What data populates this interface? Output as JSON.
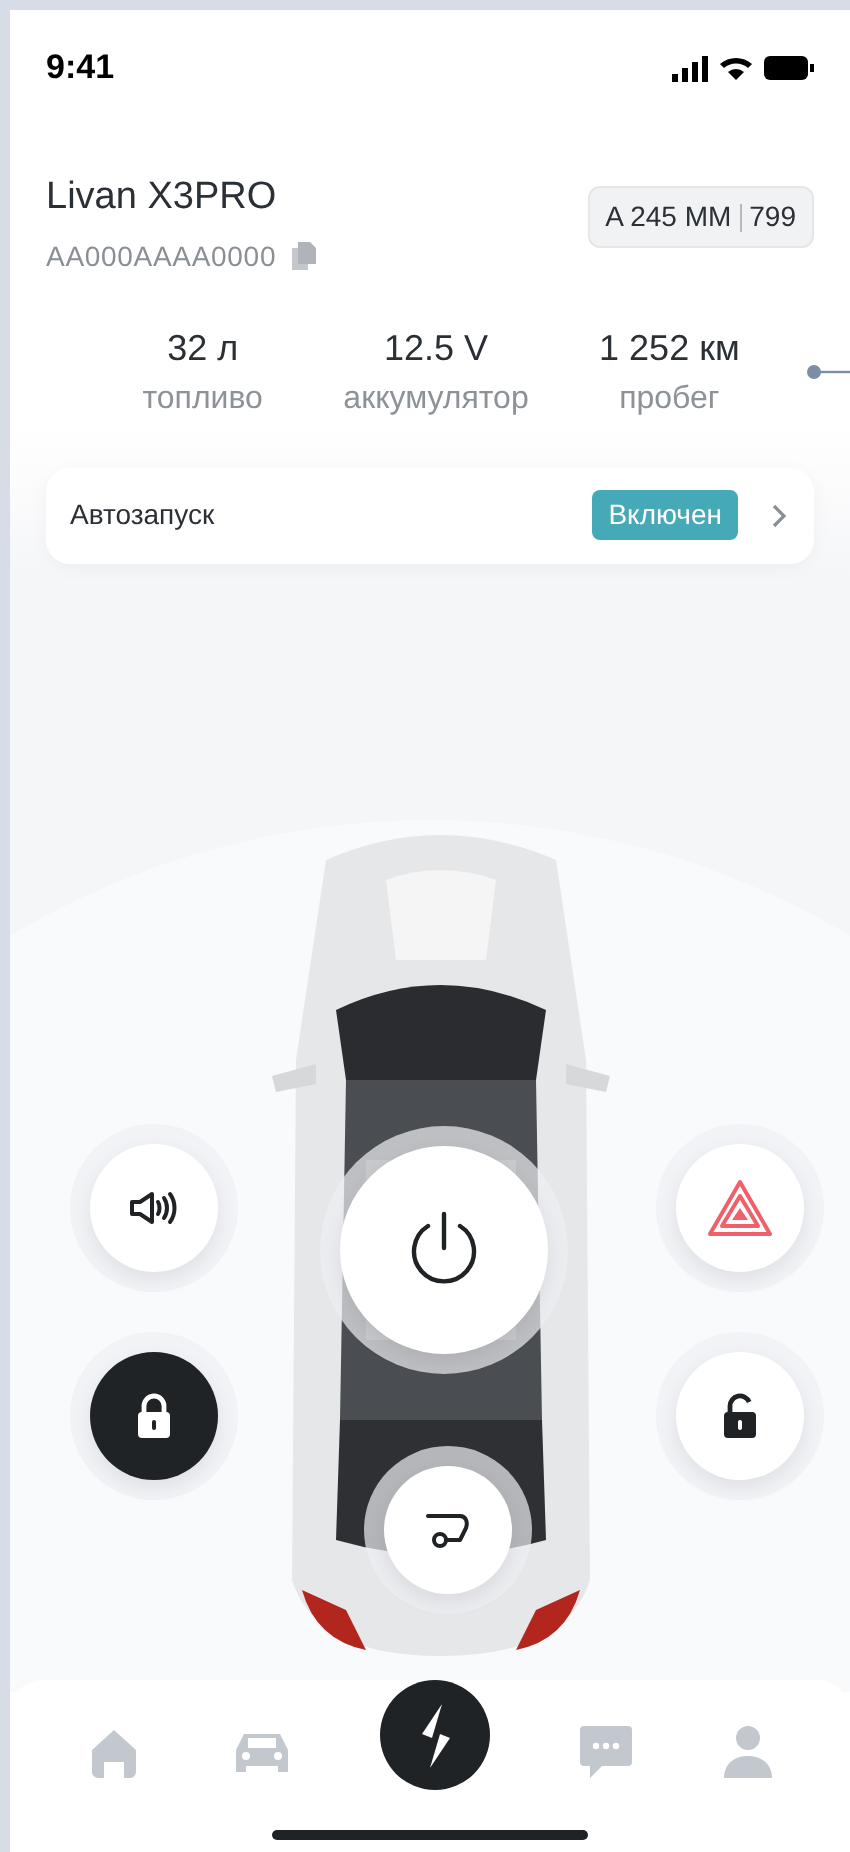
{
  "status_bar": {
    "time": "9:41"
  },
  "vehicle": {
    "name": "Livan X3PRO",
    "vin": "AA000AAAA0000",
    "plate": "A 245 MM",
    "region": "799"
  },
  "stats": [
    {
      "value": "32 л",
      "label": "топливо"
    },
    {
      "value": "12.5 V",
      "label": "аккумулятор"
    },
    {
      "value": "1 252 км",
      "label": "пробег"
    }
  ],
  "autostart": {
    "label": "Автозапуск",
    "status": "Включен",
    "on": true
  },
  "controls": [
    {
      "kind": "horn",
      "active": false
    },
    {
      "kind": "lock",
      "active": true
    },
    {
      "kind": "hazard",
      "active": false
    },
    {
      "kind": "unlock",
      "active": false
    },
    {
      "kind": "power",
      "active": false
    },
    {
      "kind": "trunk",
      "active": false
    }
  ],
  "nav": [
    {
      "kind": "home"
    },
    {
      "kind": "car"
    },
    {
      "kind": "brand"
    },
    {
      "kind": "chat"
    },
    {
      "kind": "profile"
    }
  ]
}
